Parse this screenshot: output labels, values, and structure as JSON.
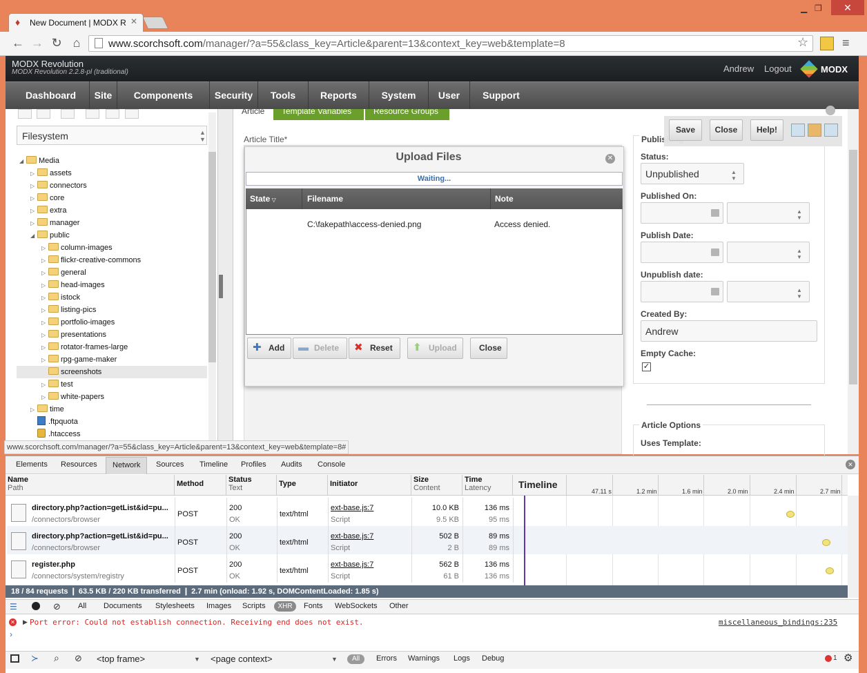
{
  "browser": {
    "tab_title": "New Document | MODX R",
    "url_host": "www.scorchsoft.com",
    "url_path": "/manager/?a=55&class_key=Article&parent=13&context_key=web&template=8"
  },
  "modx": {
    "title": "MODX Revolution",
    "version": "MODX Revolution 2.2.8-pl (traditional)",
    "user": "Andrew",
    "logout": "Logout",
    "logo_text": "MODX",
    "nav": [
      "Dashboard",
      "Site",
      "Components",
      "Security",
      "Tools",
      "Reports",
      "System",
      "User",
      "Support"
    ]
  },
  "filesystem": {
    "select_label": "Filesystem",
    "tree": [
      {
        "label": "Media",
        "depth": 0,
        "kind": "folder",
        "expanded": true
      },
      {
        "label": "assets",
        "depth": 1,
        "kind": "folder"
      },
      {
        "label": "connectors",
        "depth": 1,
        "kind": "folder"
      },
      {
        "label": "core",
        "depth": 1,
        "kind": "folder"
      },
      {
        "label": "extra",
        "depth": 1,
        "kind": "folder"
      },
      {
        "label": "manager",
        "depth": 1,
        "kind": "folder"
      },
      {
        "label": "public",
        "depth": 1,
        "kind": "folder",
        "expanded": true
      },
      {
        "label": "column-images",
        "depth": 2,
        "kind": "folder"
      },
      {
        "label": "flickr-creative-commons",
        "depth": 2,
        "kind": "folder"
      },
      {
        "label": "general",
        "depth": 2,
        "kind": "folder"
      },
      {
        "label": "head-images",
        "depth": 2,
        "kind": "folder"
      },
      {
        "label": "istock",
        "depth": 2,
        "kind": "folder"
      },
      {
        "label": "listing-pics",
        "depth": 2,
        "kind": "folder"
      },
      {
        "label": "portfolio-images",
        "depth": 2,
        "kind": "folder"
      },
      {
        "label": "presentations",
        "depth": 2,
        "kind": "folder"
      },
      {
        "label": "rotator-frames-large",
        "depth": 2,
        "kind": "folder"
      },
      {
        "label": "rpg-game-maker",
        "depth": 2,
        "kind": "folder"
      },
      {
        "label": "screenshots",
        "depth": 2,
        "kind": "folder",
        "selected": true
      },
      {
        "label": "test",
        "depth": 2,
        "kind": "folder"
      },
      {
        "label": "white-papers",
        "depth": 2,
        "kind": "folder"
      },
      {
        "label": "time",
        "depth": 1,
        "kind": "folder"
      },
      {
        "label": ".ftpquota",
        "depth": 1,
        "kind": "file"
      },
      {
        "label": ".htaccess",
        "depth": 1,
        "kind": "lock"
      }
    ]
  },
  "content": {
    "tabs": [
      "Article",
      "Template Variables",
      "Resource Groups"
    ],
    "article_title_label": "Article Title*"
  },
  "actions": {
    "save": "Save",
    "close": "Close",
    "help": "Help!"
  },
  "upload": {
    "title": "Upload Files",
    "progress_text": "Waiting...",
    "columns": [
      "State",
      "Filename",
      "Note"
    ],
    "rows": [
      {
        "state": "",
        "filename": "C:\\fakepath\\access-denied.png",
        "note": "Access denied."
      }
    ],
    "buttons": {
      "add": "Add",
      "delete": "Delete",
      "reset": "Reset",
      "upload": "Upload",
      "close": "Close"
    }
  },
  "publishing": {
    "legend": "Publishing",
    "status_label": "Status:",
    "status_value": "Unpublished",
    "published_on_label": "Published On:",
    "publish_date_label": "Publish Date:",
    "unpublish_date_label": "Unpublish date:",
    "created_by_label": "Created By:",
    "created_by_value": "Andrew",
    "empty_cache_label": "Empty Cache:",
    "empty_cache_checked": true,
    "article_options_legend": "Article Options",
    "uses_template_label": "Uses Template:"
  },
  "status_url": "www.scorchsoft.com/manager/?a=55&class_key=Article&parent=13&context_key=web&template=8#",
  "devtools": {
    "tabs": [
      "Elements",
      "Resources",
      "Network",
      "Sources",
      "Timeline",
      "Profiles",
      "Audits",
      "Console"
    ],
    "active_tab": "Network",
    "columns": [
      {
        "top": "Name",
        "sub": "Path"
      },
      {
        "top": "Method",
        "sub": ""
      },
      {
        "top": "Status",
        "sub": "Text"
      },
      {
        "top": "Type",
        "sub": ""
      },
      {
        "top": "Initiator",
        "sub": ""
      },
      {
        "top": "Size",
        "sub": "Content"
      },
      {
        "top": "Time",
        "sub": "Latency"
      }
    ],
    "timeline_label": "Timeline",
    "timeline_ticks": [
      "47.11 s",
      "1.2 min",
      "1.6 min",
      "2.0 min",
      "2.4 min",
      "2.7 min"
    ],
    "rows": [
      {
        "name": "directory.php?action=getList&id=pu...",
        "path": "/connectors/browser",
        "method": "POST",
        "status": "200",
        "status_text": "OK",
        "type": "text/html",
        "initiator": "ext-base.js:7",
        "initiator_sub": "Script",
        "size": "10.0 KB",
        "content": "9.5 KB",
        "time": "136 ms",
        "latency": "95 ms",
        "time_min": 2.45
      },
      {
        "name": "directory.php?action=getList&id=pu...",
        "path": "/connectors/browser",
        "method": "POST",
        "status": "200",
        "status_text": "OK",
        "type": "text/html",
        "initiator": "ext-base.js:7",
        "initiator_sub": "Script",
        "size": "502 B",
        "content": "2 B",
        "time": "89 ms",
        "latency": "89 ms",
        "time_min": 2.75
      },
      {
        "name": "register.php",
        "path": "/connectors/system/registry",
        "method": "POST",
        "status": "200",
        "status_text": "OK",
        "type": "text/html",
        "initiator": "ext-base.js:7",
        "initiator_sub": "Script",
        "size": "562 B",
        "content": "61 B",
        "time": "136 ms",
        "latency": "136 ms",
        "time_min": 2.78
      }
    ],
    "summary": "18 / 84 requests  ❙  63.5 KB / 220 KB transferred  ❙  2.7 min (onload: 1.92 s, DOMContentLoaded: 1.85 s)",
    "filters": [
      "All",
      "Documents",
      "Stylesheets",
      "Images",
      "Scripts",
      "XHR",
      "Fonts",
      "WebSockets",
      "Other"
    ],
    "console_error": "Port error: Could not establish connection. Receiving end does not exist.",
    "console_source": "miscellaneous_bindings:235",
    "frame_select": "<top frame>",
    "context_select": "<page context>",
    "levels": [
      "All",
      "Errors",
      "Warnings",
      "Logs",
      "Debug"
    ],
    "error_count": "1"
  }
}
